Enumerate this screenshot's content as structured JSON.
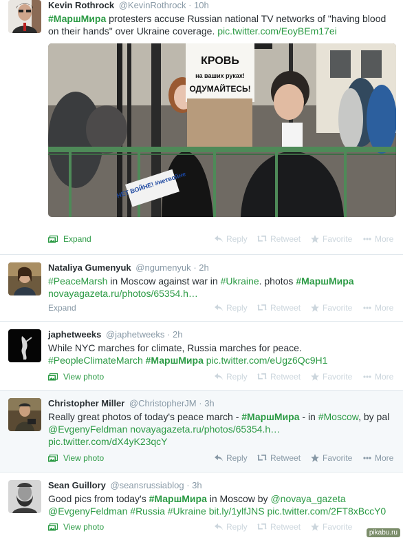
{
  "accent": "#2b9a44",
  "actions": {
    "reply": "Reply",
    "retweet": "Retweet",
    "favorite": "Favorite",
    "more": "More"
  },
  "tweets": [
    {
      "name": "Kevin Rothrock",
      "handle": "@KevinRothrock",
      "time": "10h",
      "tag": "#МаршМира",
      "text": " protesters accuse Russian national TV networks of \"having blood on their hands\" over Ukraine coverage. ",
      "link": "pic.twitter.com/EoyBEm17ei",
      "expand": "Expand",
      "photo_sign": {
        "top": "КРОВЬ",
        "mid": "на ваших руках!",
        "bot": "ОДУМАЙТЕСЬ!",
        "small": "НЕТ ВОЙНЕ! #нетвойне"
      }
    },
    {
      "name": "Nataliya Gumenyuk",
      "handle": "@ngumenyuk",
      "time": "2h",
      "t1": "#PeaceMarsh",
      "t2": " in Moscow against war in ",
      "t3": "#Ukraine",
      "t4": ". photos ",
      "t5": "#МаршМира",
      "t6": "novayagazeta.ru/photos/65354.h…",
      "expand": "Expand"
    },
    {
      "name": "japhetweeks",
      "handle": "@japhetweeks",
      "time": "2h",
      "t1": "While NYC marches for climate, Russia marches for peace.",
      "t2": "#PeopleClimateMarch",
      "t3": "#МаршМира",
      "t4": "pic.twitter.com/eUgz6Qc9H1",
      "view": "View photo"
    },
    {
      "name": "Christopher Miller",
      "handle": "@ChristopherJM",
      "time": "3h",
      "t1": "Really great photos of today's peace march - ",
      "t2": "#МаршМира",
      "t3": " - in ",
      "t4": "#Moscow",
      "t5": ", by pal ",
      "t6": "@EvgenyFeldman",
      "t7": "novayagazeta.ru/photos/65354.h…",
      "t8": "pic.twitter.com/dX4yK23qcY",
      "view": "View photo"
    },
    {
      "name": "Sean Guillory",
      "handle": "@seansrussiablog",
      "time": "3h",
      "t1": "Good pics from today's ",
      "t2": "#МаршМира",
      "t3": " in Moscow by ",
      "t4": "@novaya_gazeta",
      "t5": "@EvgenyFeldman",
      "t6": "#Russia",
      "t7": "#Ukraine",
      "t8": "bit.ly/1ylfJNS",
      "t9": "pic.twitter.com/2FT8xBccY0",
      "view": "View photo"
    }
  ],
  "watermark": "pikabu.ru"
}
